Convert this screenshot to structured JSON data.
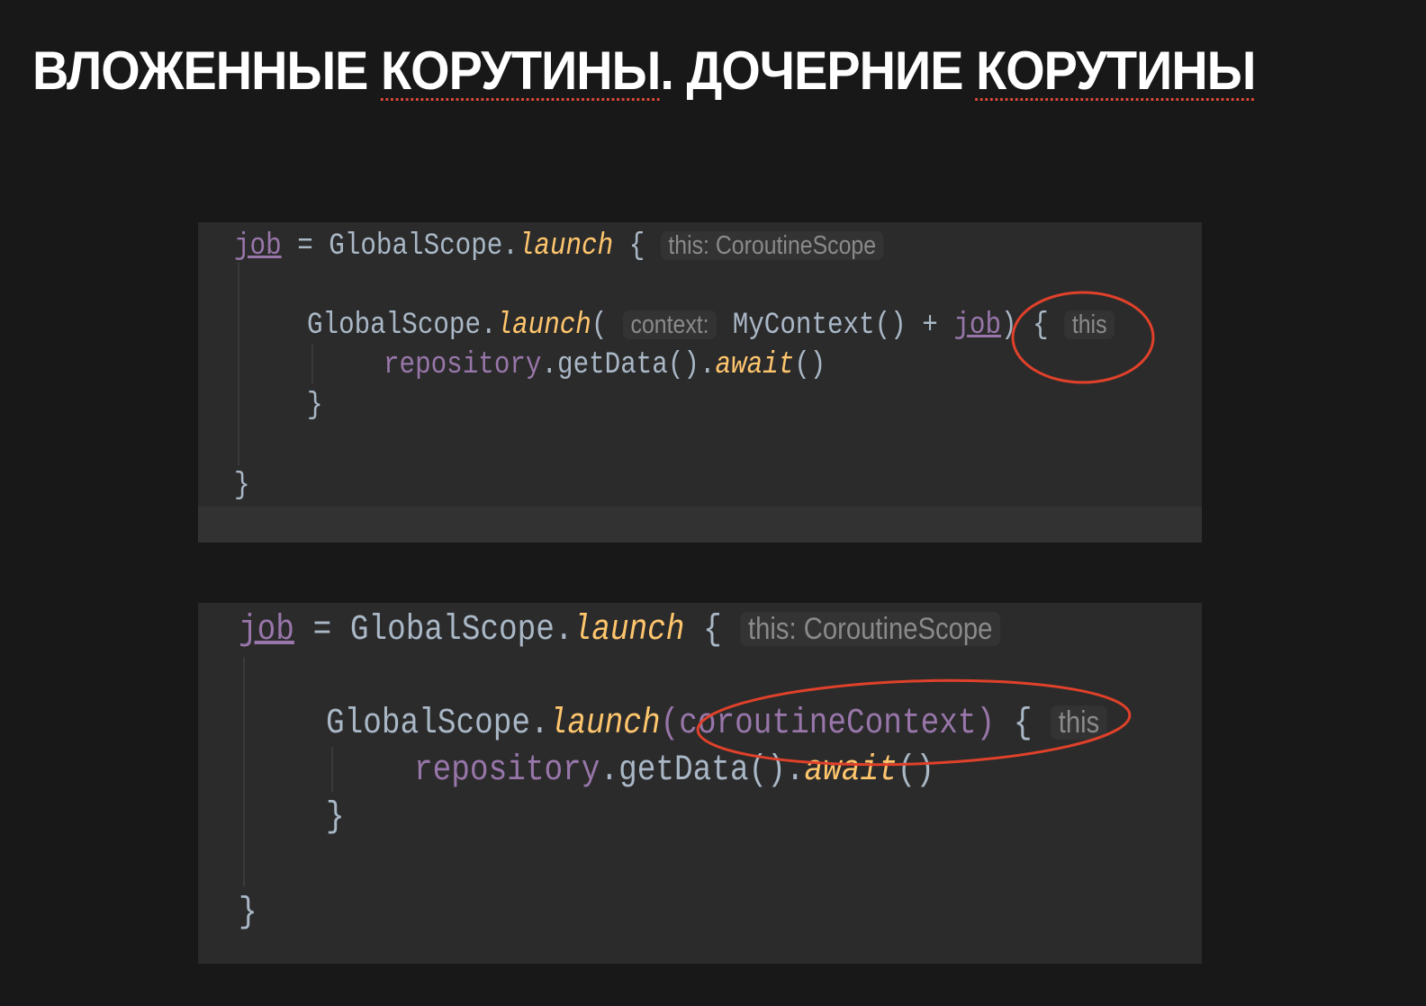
{
  "title": {
    "part1": "ВЛОЖЕННЫЕ ",
    "part2": "КОРУТИНЫ",
    "part3": ". ДОЧЕРНИЕ ",
    "part4": "КОРУТИНЫ"
  },
  "snippet1": {
    "l1_var": "job",
    "l1_mid": " = GlobalScope.",
    "l1_fn": "launch",
    "l1_brace": " { ",
    "l1_hint": "this: CoroutineScope",
    "l2_a": "GlobalScope.",
    "l2_fn": "launch",
    "l2_paren": "( ",
    "l2_hint": "context:",
    "l2_ctx": " MyContext() + ",
    "l2_var": "job",
    "l2_end": ") { ",
    "l2_hint2": "this",
    "l3_var": "repository",
    "l3_mid": ".getData().",
    "l3_fn": "await",
    "l3_end": "()",
    "l4": "}",
    "l5": "}"
  },
  "snippet2": {
    "l1_var": "job",
    "l1_mid": " = GlobalScope.",
    "l1_fn": "launch",
    "l1_brace": " { ",
    "l1_hint": "this: CoroutineScope",
    "l2_a": "GlobalScope.",
    "l2_fn": "launch",
    "l2_ctx": "(coroutineContext)",
    "l2_end": " { ",
    "l2_hint2": "this",
    "l3_var": "repository",
    "l3_mid": ".getData().",
    "l3_fn": "await",
    "l3_end": "()",
    "l4": "}",
    "l5": "}"
  },
  "colors": {
    "highlight": "#e0412a"
  }
}
